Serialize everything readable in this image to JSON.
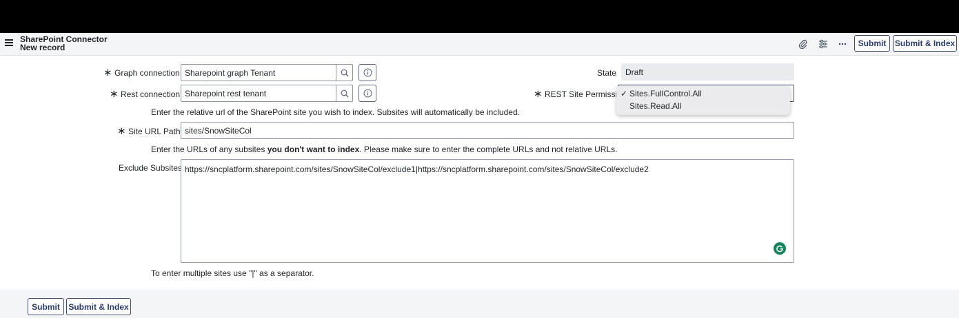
{
  "header": {
    "title": "SharePoint Connector",
    "subtitle": "New record",
    "submit_label": "Submit",
    "submit_index_label": "Submit & Index"
  },
  "form": {
    "graph_connection": {
      "label": "Graph connection",
      "value": "Sharepoint graph Tenant"
    },
    "rest_connection": {
      "label": "Rest connection",
      "value": "Sharepoint rest tenant"
    },
    "state": {
      "label": "State",
      "value": "Draft"
    },
    "rest_site_permission": {
      "label": "REST Site Permission",
      "options": [
        "Sites.FullControl.All",
        "Sites.Read.All"
      ],
      "selected": "Sites.FullControl.All",
      "check": "✓"
    },
    "site_url_hint": "Enter the relative url of the SharePoint site you wish to index. Subsites will automatically be included.",
    "site_url_path": {
      "label": "Site URL Path",
      "value": "sites/SnowSiteCol"
    },
    "exclude_hint_pre": "Enter the URLs of any subsites ",
    "exclude_hint_bold": "you don't want to index",
    "exclude_hint_post": ". Please make sure to enter the complete URLs and not relative URLs.",
    "exclude_subsites": {
      "label": "Exclude Subsites",
      "value": "https://sncplatform.sharepoint.com/sites/SnowSiteCol/exclude1|https://sncplatform.sharepoint.com/sites/SnowSiteCol/exclude2"
    },
    "separator_hint": "To enter multiple sites use \"|\" as a separator."
  },
  "footer": {
    "submit_label": "Submit",
    "submit_index_label": "Submit & Index"
  },
  "icons": {
    "menu": "hamburger-icon",
    "attachment": "paperclip-icon",
    "personalize": "sliders-icon",
    "more": "more-icon",
    "lookup": "search-icon",
    "info": "info-icon",
    "grammarly": "grammarly-icon"
  },
  "colors": {
    "accent": "#2a3c6b",
    "header_bg": "#f4f5f7",
    "grammarly": "#15855f"
  }
}
